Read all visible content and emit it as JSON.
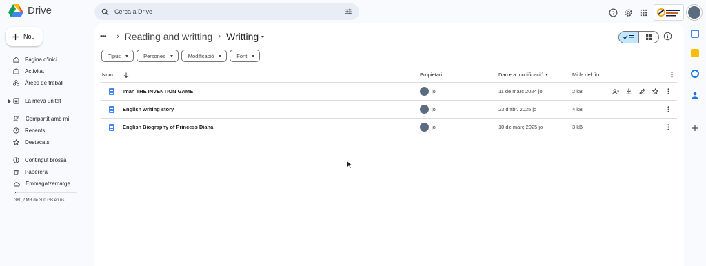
{
  "app": {
    "name": "Drive"
  },
  "search": {
    "placeholder": "Cerca a Drive"
  },
  "new_button": {
    "label": "Nou"
  },
  "sidebar": {
    "items": [
      {
        "label": "Pàgina d'inici",
        "icon": "home-icon"
      },
      {
        "label": "Activitat",
        "icon": "activity-icon"
      },
      {
        "label": "Àrees de treball",
        "icon": "workspaces-icon"
      },
      {
        "label": "La meva unitat",
        "icon": "my-drive-icon"
      },
      {
        "label": "Compartit amb mi",
        "icon": "shared-icon"
      },
      {
        "label": "Recents",
        "icon": "clock-icon"
      },
      {
        "label": "Destacats",
        "icon": "star-icon"
      },
      {
        "label": "Contingut brossa",
        "icon": "spam-icon"
      },
      {
        "label": "Paperera",
        "icon": "trash-icon"
      },
      {
        "label": "Emmagatzematge",
        "icon": "cloud-icon"
      }
    ],
    "storage_text": "380,2 MB de 300 GB en ús",
    "storage_fraction": 0.0013
  },
  "breadcrumb": {
    "dots": "•••",
    "parent": "Reading and writting",
    "current": "Writting"
  },
  "filters": [
    "Tipus",
    "Persones",
    "Modificació",
    "Font"
  ],
  "table": {
    "headers": {
      "name": "Nom",
      "owner": "Propietari",
      "modified": "Darrera modificació",
      "size": "Mida del fitx"
    },
    "rows": [
      {
        "name": "Iman THE INVENTION GAME",
        "owner": "jo",
        "modified": "11 de març 2024 jo",
        "size": "2 kB"
      },
      {
        "name": "English writing story",
        "owner": "jo",
        "modified": "23 d'abr. 2025 jo",
        "size": "4 kB"
      },
      {
        "name": "English Biography of Princess Diana",
        "owner": "jo",
        "modified": "10 de març 2025 jo",
        "size": "3 kB"
      }
    ]
  },
  "colors": {
    "accent": "#0b57d0",
    "selected": "#c2e7ff",
    "doc": "#4285f4"
  }
}
